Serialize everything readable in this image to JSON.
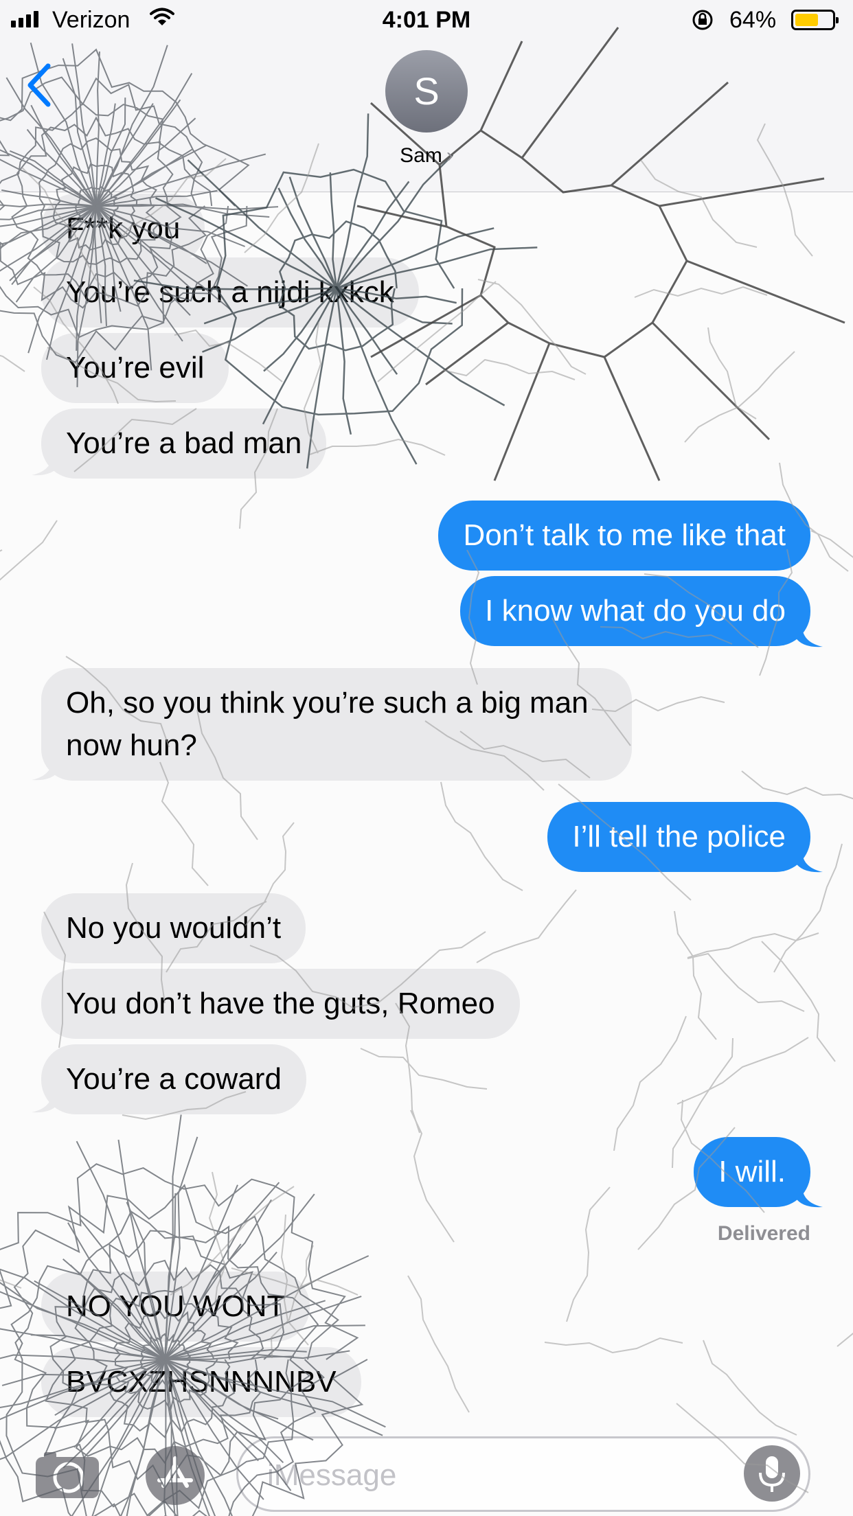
{
  "status_bar": {
    "carrier": "Verizon",
    "time": "4:01 PM",
    "battery_percent": "64%",
    "battery_level": 0.64
  },
  "header": {
    "avatar_initial": "S",
    "contact_name": "Sam",
    "chevron": "›"
  },
  "messages": [
    {
      "direction": "incoming",
      "text": "F**k you"
    },
    {
      "direction": "incoming",
      "text": "You’re such a nijdi kxkck"
    },
    {
      "direction": "incoming",
      "text": "You’re evil"
    },
    {
      "direction": "incoming",
      "text": "You’re a bad man"
    },
    {
      "direction": "outgoing",
      "text": "Don’t talk to me like that"
    },
    {
      "direction": "outgoing",
      "text": "I know what do you do"
    },
    {
      "direction": "incoming",
      "text": "Oh, so you think you’re such a big man now hun?"
    },
    {
      "direction": "outgoing",
      "text": "I’ll tell the police"
    },
    {
      "direction": "incoming",
      "text": "No you wouldn’t"
    },
    {
      "direction": "incoming",
      "text": "You don’t have the guts, Romeo"
    },
    {
      "direction": "incoming",
      "text": "You’re a coward"
    },
    {
      "direction": "outgoing",
      "text": "I will."
    },
    {
      "direction": "incoming",
      "text": "NO YOU WONT"
    },
    {
      "direction": "incoming",
      "text": "BVCXZHSNNNNBV"
    }
  ],
  "delivered_label": "Delivered",
  "input": {
    "placeholder": "iMessage"
  },
  "icons": [
    "back-chevron-icon",
    "camera-icon",
    "app-store-icon",
    "microphone-icon",
    "wifi-icon",
    "orientation-lock-icon",
    "battery-icon"
  ],
  "colors": {
    "outgoing_bubble": "#1f8cf5",
    "incoming_bubble": "#e9e9eb",
    "ios_blue": "#007aff",
    "battery_fill": "#ffcc00"
  }
}
